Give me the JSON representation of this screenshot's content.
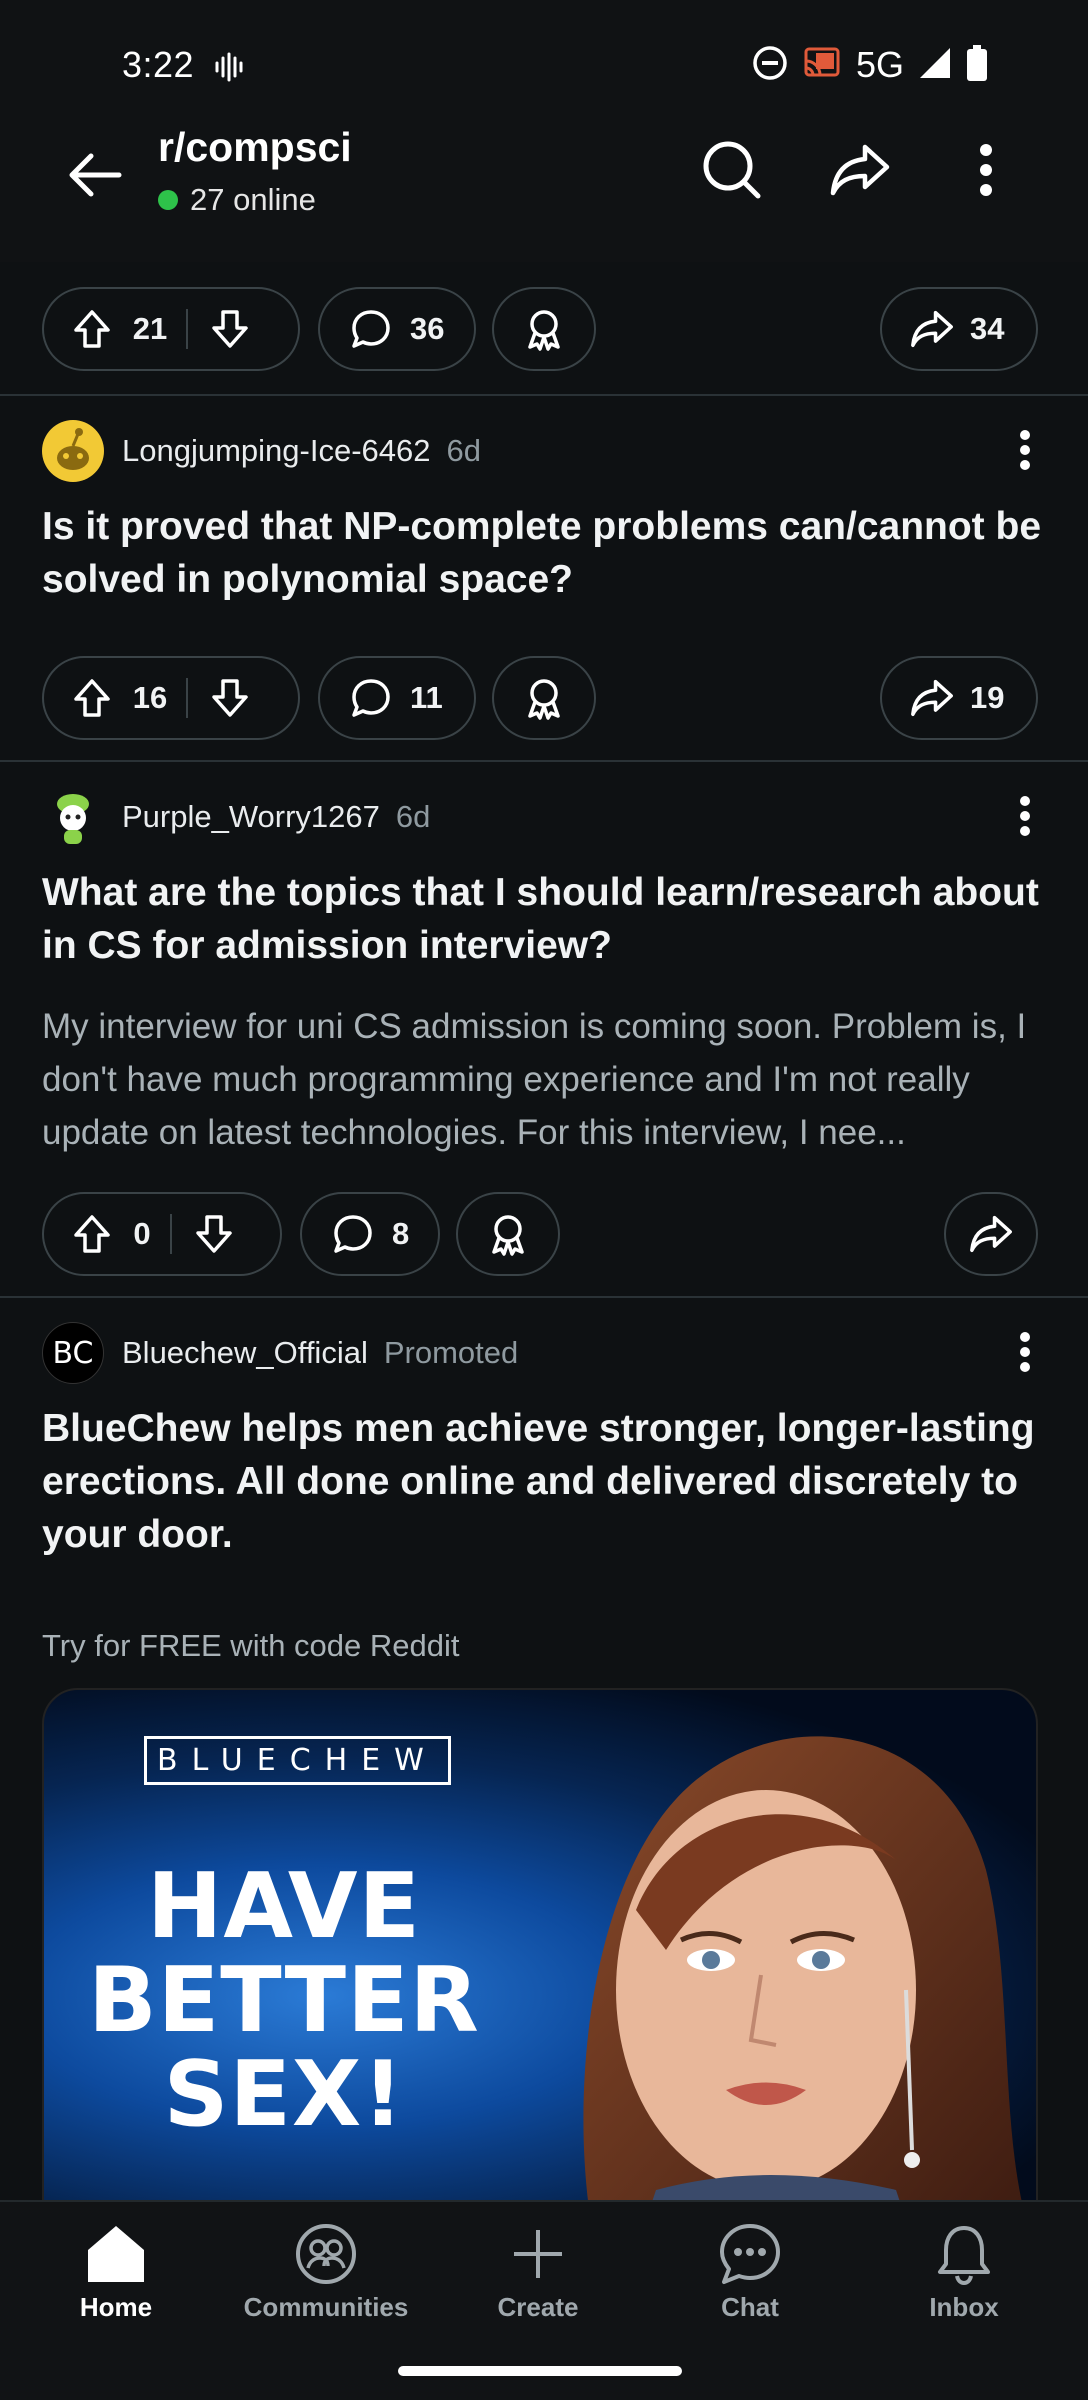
{
  "status_bar": {
    "time": "3:22",
    "network": "5G"
  },
  "header": {
    "back_label": "Back",
    "subreddit": "r/compsci",
    "online": "27 online"
  },
  "posts": [
    {
      "upvotes": "21",
      "comments": "36",
      "shares": "34"
    },
    {
      "username": "Longjumping-Ice-6462",
      "age": "6d",
      "title": "Is it proved that NP-complete problems can/cannot be solved in polynomial space?",
      "upvotes": "16",
      "comments": "11",
      "shares": "19"
    },
    {
      "username": "Purple_Worry1267",
      "age": "6d",
      "title": "What are the topics that I should learn/research about in CS for admission interview?",
      "body": "My interview for uni CS admission is coming soon. Problem is, I don't have much programming experience and I'm not really update on latest technologies. For this interview, I nee...",
      "upvotes": "0",
      "comments": "8"
    }
  ],
  "ad": {
    "username": "Bluechew_Official",
    "avatar_text": "BC",
    "tag": "Promoted",
    "title": "BlueChew helps men achieve stronger, longer-lasting erections. All done online and delivered discretely to your door.",
    "subtitle": "Try for FREE with code Reddit",
    "image_brand": "BLUECHEW",
    "image_headline": "HAVE BETTER SEX!"
  },
  "nav": {
    "items": [
      {
        "label": "Home",
        "icon": "home-icon"
      },
      {
        "label": "Communities",
        "icon": "communities-icon"
      },
      {
        "label": "Create",
        "icon": "plus-icon"
      },
      {
        "label": "Chat",
        "icon": "chat-icon"
      },
      {
        "label": "Inbox",
        "icon": "bell-icon"
      }
    ]
  },
  "colors": {
    "background": "#0e1113",
    "online_dot": "#2ec24a",
    "text_muted": "#8f9aa0"
  }
}
